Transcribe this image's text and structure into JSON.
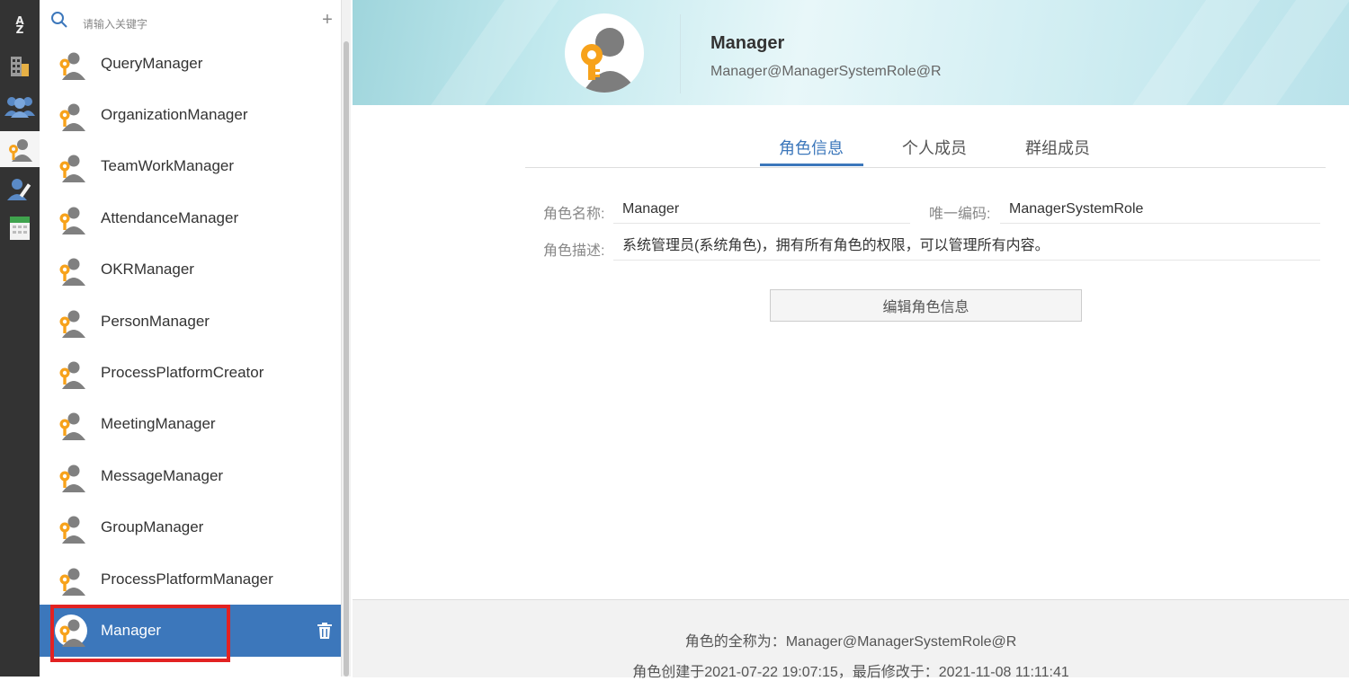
{
  "search": {
    "placeholder": "请输入关键字"
  },
  "roles": [
    {
      "name": "QueryManager"
    },
    {
      "name": "OrganizationManager"
    },
    {
      "name": "TeamWorkManager"
    },
    {
      "name": "AttendanceManager"
    },
    {
      "name": "OKRManager"
    },
    {
      "name": "PersonManager"
    },
    {
      "name": "ProcessPlatformCreator"
    },
    {
      "name": "MeetingManager"
    },
    {
      "name": "MessageManager"
    },
    {
      "name": "GroupManager"
    },
    {
      "name": "ProcessPlatformManager"
    },
    {
      "name": "Manager",
      "selected": true
    }
  ],
  "header": {
    "title": "Manager",
    "subtitle": "Manager@ManagerSystemRole@R"
  },
  "tabs": [
    {
      "label": "角色信息",
      "active": true
    },
    {
      "label": "个人成员"
    },
    {
      "label": "群组成员"
    }
  ],
  "form": {
    "name_label": "角色名称:",
    "name_value": "Manager",
    "code_label": "唯一编码:",
    "code_value": "ManagerSystemRole",
    "desc_label": "角色描述:",
    "desc_value": "系统管理员(系统角色)，拥有所有角色的权限，可以管理所有内容。",
    "edit_button": "编辑角色信息"
  },
  "footer": {
    "fullname": "角色的全称为：Manager@ManagerSystemRole@R",
    "created": "角色创建于2021-07-22 19:07:15，最后修改于：2021-11-08 11:11:41"
  },
  "colors": {
    "accent": "#3c77bb",
    "rail_bg": "#333333",
    "highlight": "#e22222",
    "role_badge": "#f7a21b"
  },
  "icons": {
    "rail": [
      "sort-icon",
      "building-icon",
      "group-icon",
      "role-icon",
      "person-edit-icon",
      "calendar-icon"
    ],
    "list": [
      "search-icon",
      "add-icon",
      "role-avatar-icon",
      "trash-icon"
    ]
  }
}
